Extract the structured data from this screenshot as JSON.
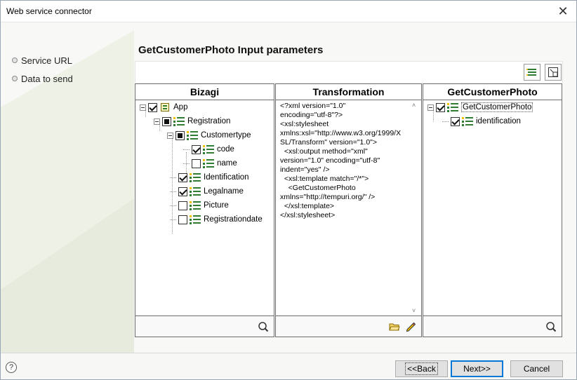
{
  "window": {
    "title": "Web service connector"
  },
  "nav": {
    "items": [
      {
        "label": "Service URL"
      },
      {
        "label": "Data to send"
      }
    ]
  },
  "section": {
    "title": "GetCustomerPhoto Input parameters"
  },
  "toolbar": {
    "icons": [
      "list-view-icon",
      "layout-icon"
    ]
  },
  "panels": {
    "bizagi": {
      "header": "Bizagi",
      "tree": [
        {
          "label": "App",
          "state": "checked",
          "icon": "app-icon"
        },
        {
          "label": "Registration",
          "state": "partial",
          "icon": "entity-icon"
        },
        {
          "label": "Customertype",
          "state": "partial",
          "icon": "entity-icon"
        },
        {
          "label": "code",
          "state": "checked",
          "icon": "attribute-icon"
        },
        {
          "label": "name",
          "state": "unchecked",
          "icon": "attribute-icon"
        },
        {
          "label": "Identification",
          "state": "checked",
          "icon": "attribute-icon"
        },
        {
          "label": "Legalname",
          "state": "checked",
          "icon": "attribute-icon"
        },
        {
          "label": "Picture",
          "state": "unchecked",
          "icon": "attribute-icon"
        },
        {
          "label": "Registrationdate",
          "state": "unchecked",
          "icon": "attribute-icon"
        }
      ]
    },
    "transformation": {
      "header": "Transformation",
      "text": "<?xml version=\"1.0\"\nencoding=\"utf-8\"?>\n<xsl:stylesheet\nxmlns:xsl=\"http://www.w3.org/1999/XSL/Transform\" version=\"1.0\">\n  <xsl:output method=\"xml\"\nversion=\"1.0\" encoding=\"utf-8\"\nindent=\"yes\" />\n  <xsl:template match=\"/*\">\n    <GetCustomerPhoto\nxmlns=\"http://tempuri.org/\" />\n  </xsl:template>\n</xsl:stylesheet>"
    },
    "target": {
      "header": "GetCustomerPhoto",
      "tree": [
        {
          "label": "GetCustomerPhoto",
          "state": "checked",
          "icon": "entity-icon"
        },
        {
          "label": "identification",
          "state": "checked",
          "icon": "attribute-icon"
        }
      ]
    }
  },
  "buttons": {
    "back": "<<Back",
    "next": "Next>>",
    "cancel": "Cancel",
    "help": "?"
  },
  "colors": {
    "accent": "#0078d7",
    "icon_green": "#2e7d32",
    "icon_yellow": "#f2c200"
  }
}
